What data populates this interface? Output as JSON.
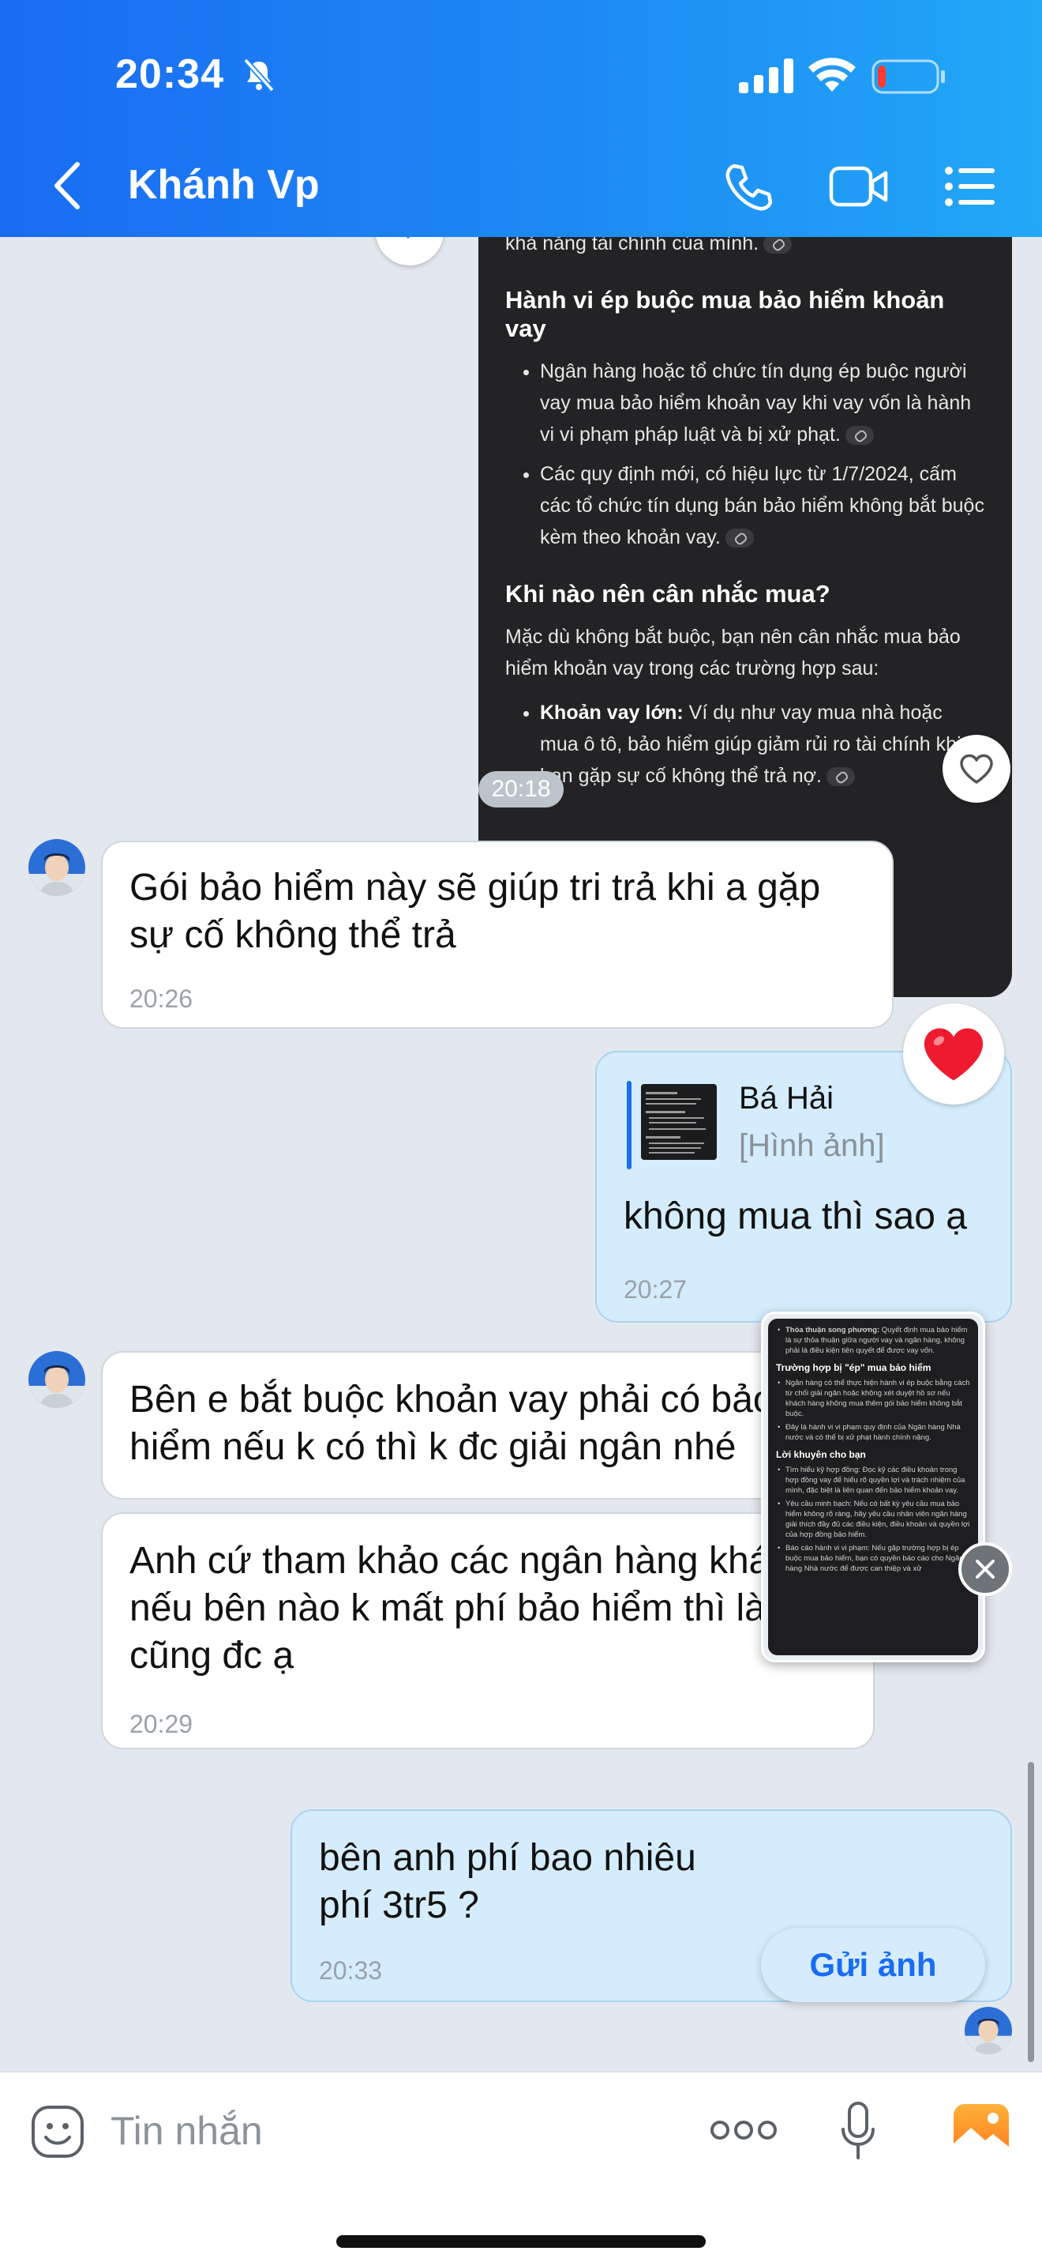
{
  "status_bar": {
    "time": "20:34"
  },
  "header": {
    "title": "Khánh Vp"
  },
  "dark_card": {
    "top_fragment": "khả năng tài chính của mình.",
    "section1_title": "Hành vi ép buộc mua bảo hiểm khoản vay",
    "section1_items": [
      "Ngân hàng hoặc tổ chức tín dụng ép buộc người vay mua bảo hiểm khoản vay khi vay vốn là hành vi vi phạm pháp luật và bị xử phạt.",
      "Các quy định mới, có hiệu lực từ 1/7/2024, cấm các tổ chức tín dụng bán bảo hiểm không bắt buộc kèm theo khoản vay."
    ],
    "section2_title": "Khi nào nên cân nhắc mua?",
    "section2_intro": "Mặc dù không bắt buộc, bạn nên cân nhắc mua bảo hiểm khoản vay trong các trường hợp sau:",
    "section2_item_bold": "Khoản vay lớn:",
    "section2_item_text": " Ví dụ như vay mua nhà hoặc mua ô tô, bảo hiểm giúp giảm rủi ro tài chính khi bạn gặp sự cố không thể trả nợ.",
    "time": "20:18"
  },
  "messages": [
    {
      "id": "m1",
      "text": "Gói bảo hiểm này sẽ giúp tri trả khi a gặp sự cố không thể trả",
      "time": "20:26"
    },
    {
      "id": "m2",
      "quote_name": "Bá Hải",
      "quote_sub": "[Hình ảnh]",
      "text": "không mua thì sao ạ",
      "time": "20:27"
    },
    {
      "id": "m3",
      "text": "Bên e bắt buộc khoản vay phải có bảo hiểm nếu k có thì k đc giải ngân nhé"
    },
    {
      "id": "m4",
      "text": "Anh cứ tham khảo các ngân hàng khác nếu bên nào k mất phí bảo hiểm thì làm cũng đc ạ",
      "time": "20:29"
    },
    {
      "id": "m5",
      "text": "bên anh phí bao nhiêu phí 3tr5 ?",
      "time": "20:33"
    }
  ],
  "preview": {
    "intro_bold": "Thỏa thuận song phương:",
    "intro_text": " Quyết định mua bảo hiểm là sự thỏa thuận giữa người vay và ngân hàng, không phải là điều kiện tiên quyết để được vay vốn.",
    "h1": "Trường hợp bị \"ép\" mua bảo hiểm",
    "h1_items": [
      "Ngân hàng có thể thực hiện hành vi ép buộc bằng cách từ chối giải ngân hoặc không xét duyệt hồ sơ nếu khách hàng không mua thêm gói bảo hiểm không bắt buộc.",
      "Đây là hành vi vi phạm quy định của Ngân hàng Nhà nước và có thể bị xử phạt hành chính nặng."
    ],
    "h2": "Lời khuyên cho bạn",
    "h2_items": [
      "Tìm hiểu kỹ hợp đồng: Đọc kỹ các điều khoản trong hợp đồng vay để hiểu rõ quyền lợi và trách nhiệm của mình, đặc biệt là liên quan đến bảo hiểm khoản vay.",
      "Yêu cầu minh bạch: Nếu có bất kỳ yêu cầu mua bảo hiểm không rõ ràng, hãy yêu cầu nhân viên ngân hàng giải thích đầy đủ các điều kiện, điều khoản và quyền lợi của hợp đồng bảo hiểm.",
      "Báo cáo hành vi vi phạm: Nếu gặp trường hợp bị ép buộc mua bảo hiểm, bạn có quyền báo cáo cho Ngân hàng Nhà nước để được can thiệp và xử"
    ],
    "send_label": "Gửi ảnh"
  },
  "input": {
    "placeholder": "Tin nhắn"
  }
}
